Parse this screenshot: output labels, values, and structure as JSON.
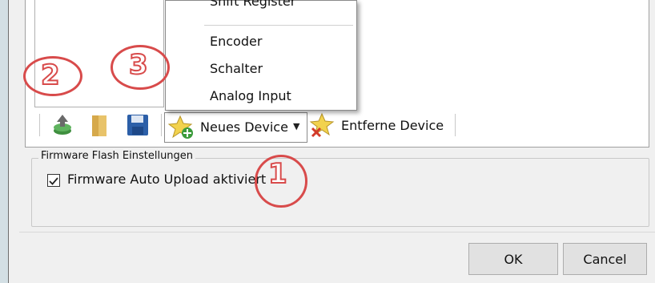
{
  "dropdown": {
    "partial_item": "Shift Register",
    "items": [
      "Encoder",
      "Schalter",
      "Analog Input"
    ]
  },
  "toolbar": {
    "add_device_label": "Neues Device",
    "remove_device_label": "Entferne Device"
  },
  "firmware": {
    "group_title": "Firmware Flash Einstellungen",
    "auto_upload_label": "Firmware Auto Upload aktiviert",
    "auto_upload_checked": true
  },
  "buttons": {
    "ok": "OK",
    "cancel": "Cancel"
  },
  "annotations": [
    "1",
    "2",
    "3"
  ],
  "colors": {
    "annotation": "#d84b4b",
    "background": "#d3dfe4",
    "dialog": "#f0f0f0"
  }
}
